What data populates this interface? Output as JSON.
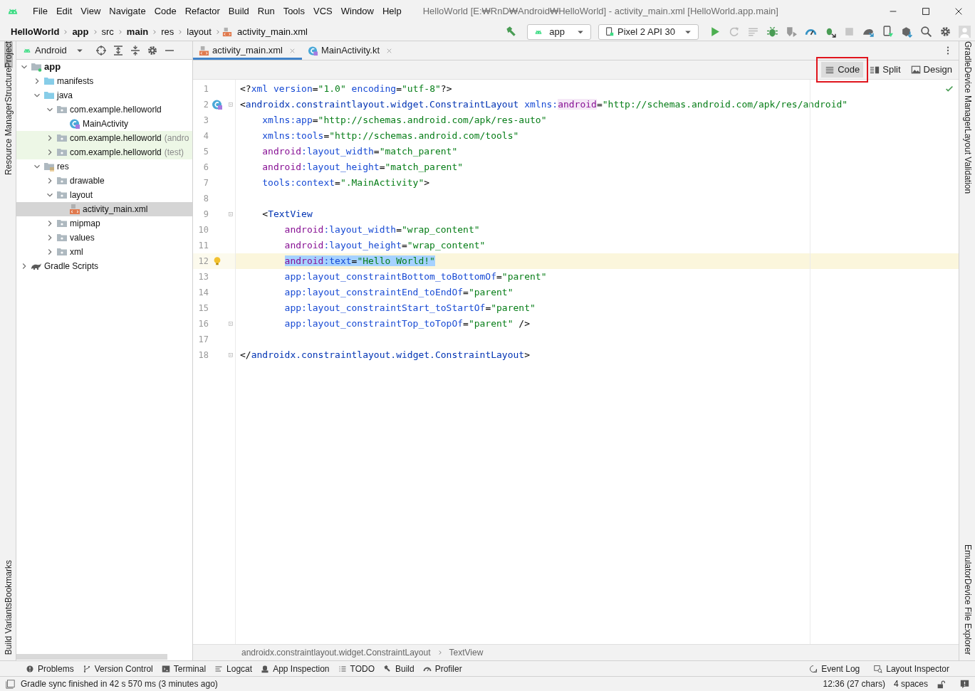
{
  "window": {
    "title": "HelloWorld [E:₩RnD₩Android₩HelloWorld] - activity_main.xml [HelloWorld.app.main]"
  },
  "menu": [
    "File",
    "Edit",
    "View",
    "Navigate",
    "Code",
    "Refactor",
    "Build",
    "Run",
    "Tools",
    "VCS",
    "Window",
    "Help"
  ],
  "nav_bar": {
    "breadcrumbs": [
      {
        "label": "HelloWorld",
        "bold": true,
        "kind": "text"
      },
      {
        "label": "app",
        "bold": true,
        "kind": "text"
      },
      {
        "label": "src",
        "bold": false,
        "kind": "text"
      },
      {
        "label": "main",
        "bold": true,
        "kind": "text"
      },
      {
        "label": "res",
        "bold": false,
        "kind": "text"
      },
      {
        "label": "layout",
        "bold": false,
        "kind": "text"
      },
      {
        "label": "activity_main.xml",
        "bold": false,
        "kind": "xml"
      }
    ]
  },
  "toolbar": {
    "run_config": "app",
    "device": "Pixel 2 API 30"
  },
  "stripes": {
    "left_top": [
      {
        "label": "Project",
        "selected": true
      },
      {
        "label": "Structure",
        "selected": false
      },
      {
        "label": "Resource Manager",
        "selected": false
      }
    ],
    "left_bottom": [
      {
        "label": "Bookmarks",
        "selected": false
      },
      {
        "label": "Build Variants",
        "selected": false
      }
    ],
    "right_top": [
      {
        "label": "Gradle",
        "selected": false
      },
      {
        "label": "Device Manager",
        "selected": false
      },
      {
        "label": "Layout Validation",
        "selected": false
      }
    ],
    "right_bottom": [
      {
        "label": "Emulator",
        "selected": false
      },
      {
        "label": "Device File Explorer",
        "selected": false
      }
    ]
  },
  "project_panel": {
    "view": "Android",
    "tree": [
      {
        "label": "app",
        "kind": "module",
        "expanded": true,
        "selected": false,
        "test_scope": false,
        "children": [
          {
            "label": "manifests",
            "kind": "folder",
            "expanded": false,
            "selected": false,
            "test_scope": false
          },
          {
            "label": "java",
            "kind": "folder",
            "expanded": true,
            "selected": false,
            "test_scope": false,
            "children": [
              {
                "label": "com.example.helloworld",
                "kind": "package",
                "expanded": true,
                "selected": false,
                "test_scope": false,
                "children": [
                  {
                    "label": "MainActivity",
                    "kind": "class",
                    "selected": false,
                    "test_scope": false
                  }
                ]
              },
              {
                "label": "com.example.helloworld",
                "suffix": "(andro",
                "kind": "package",
                "expanded": false,
                "selected": false,
                "test_scope": true
              },
              {
                "label": "com.example.helloworld",
                "suffix": "(test)",
                "kind": "package",
                "expanded": false,
                "selected": false,
                "test_scope": true
              }
            ]
          },
          {
            "label": "res",
            "kind": "resfolder",
            "expanded": true,
            "selected": false,
            "test_scope": false,
            "children": [
              {
                "label": "drawable",
                "kind": "package",
                "expanded": false,
                "selected": false,
                "test_scope": false
              },
              {
                "label": "layout",
                "kind": "package",
                "expanded": true,
                "selected": false,
                "test_scope": false,
                "children": [
                  {
                    "label": "activity_main.xml",
                    "kind": "xml",
                    "selected": true,
                    "test_scope": false
                  }
                ]
              },
              {
                "label": "mipmap",
                "kind": "package",
                "expanded": false,
                "selected": false,
                "test_scope": false
              },
              {
                "label": "values",
                "kind": "package",
                "expanded": false,
                "selected": false,
                "test_scope": false
              },
              {
                "label": "xml",
                "kind": "package",
                "expanded": false,
                "selected": false,
                "test_scope": false
              }
            ]
          }
        ]
      },
      {
        "label": "Gradle Scripts",
        "kind": "gradle",
        "expanded": false,
        "selected": false,
        "test_scope": false
      }
    ]
  },
  "editor": {
    "tabs": [
      {
        "label": "activity_main.xml",
        "kind": "xml",
        "selected": true
      },
      {
        "label": "MainActivity.kt",
        "kind": "class",
        "selected": false
      }
    ],
    "view_modes": [
      {
        "label": "Code",
        "kind": "code",
        "selected": true,
        "outlined": true
      },
      {
        "label": "Split",
        "kind": "split",
        "selected": false,
        "outlined": false
      },
      {
        "label": "Design",
        "kind": "design",
        "selected": false,
        "outlined": false
      }
    ],
    "lines": [
      {
        "number": "1",
        "kind": "plain",
        "indented": false,
        "nested": false,
        "current": false,
        "fold": false,
        "tokens": [
          {
            "kind": "punct",
            "text": "<?"
          },
          {
            "kind": "attr",
            "text": "xml"
          },
          {
            "kind": "attr",
            "text": " version"
          },
          {
            "kind": "punct",
            "text": "="
          },
          {
            "kind": "value",
            "text": "\"1.0\""
          },
          {
            "kind": "attr",
            "text": " encoding"
          },
          {
            "kind": "punct",
            "text": "="
          },
          {
            "kind": "value",
            "text": "\"utf-8\""
          },
          {
            "kind": "punct",
            "text": "?>"
          }
        ]
      },
      {
        "number": "2",
        "kind": "class_marker",
        "indented": false,
        "nested": false,
        "current": false,
        "fold": true,
        "tokens": [
          {
            "kind": "punct",
            "text": "<"
          },
          {
            "kind": "tag",
            "text": "androidx.constraintlayout.widget.ConstraintLayout"
          },
          {
            "kind": "attr",
            "text": " xmlns:"
          },
          {
            "kind": "nsdecl",
            "text": "android"
          },
          {
            "kind": "punct",
            "text": "="
          },
          {
            "kind": "value",
            "text": "\"http://schemas.android.com/apk/res/android\""
          }
        ]
      },
      {
        "number": "3",
        "kind": "plain",
        "indented": true,
        "nested": false,
        "current": false,
        "fold": false,
        "tokens": [
          {
            "kind": "attr",
            "text": "xmlns:app"
          },
          {
            "kind": "punct",
            "text": "="
          },
          {
            "kind": "value",
            "text": "\"http://schemas.android.com/apk/res-auto\""
          }
        ]
      },
      {
        "number": "4",
        "kind": "plain",
        "indented": true,
        "nested": false,
        "current": false,
        "fold": false,
        "tokens": [
          {
            "kind": "attr",
            "text": "xmlns:tools"
          },
          {
            "kind": "punct",
            "text": "="
          },
          {
            "kind": "value",
            "text": "\"http://schemas.android.com/tools\""
          }
        ]
      },
      {
        "number": "5",
        "kind": "plain",
        "indented": true,
        "nested": false,
        "current": false,
        "fold": false,
        "tokens": [
          {
            "kind": "ns",
            "text": "android"
          },
          {
            "kind": "attr",
            "text": ":layout_width"
          },
          {
            "kind": "punct",
            "text": "="
          },
          {
            "kind": "value",
            "text": "\"match_parent\""
          }
        ]
      },
      {
        "number": "6",
        "kind": "plain",
        "indented": true,
        "nested": false,
        "current": false,
        "fold": false,
        "tokens": [
          {
            "kind": "ns",
            "text": "android"
          },
          {
            "kind": "attr",
            "text": ":layout_height"
          },
          {
            "kind": "punct",
            "text": "="
          },
          {
            "kind": "value",
            "text": "\"match_parent\""
          }
        ]
      },
      {
        "number": "7",
        "kind": "plain",
        "indented": true,
        "nested": false,
        "current": false,
        "fold": false,
        "tokens": [
          {
            "kind": "attr",
            "text": "tools:context"
          },
          {
            "kind": "punct",
            "text": "="
          },
          {
            "kind": "value",
            "text": "\".MainActivity\""
          },
          {
            "kind": "punct",
            "text": ">"
          }
        ]
      },
      {
        "number": "8",
        "kind": "plain",
        "current": false,
        "fold": false
      },
      {
        "number": "9",
        "kind": "plain",
        "indented": true,
        "nested": false,
        "current": false,
        "fold": true,
        "tokens": [
          {
            "kind": "punct",
            "text": "<"
          },
          {
            "kind": "tag",
            "text": "TextView"
          }
        ]
      },
      {
        "number": "10",
        "kind": "plain",
        "indented": true,
        "nested": true,
        "current": false,
        "fold": false,
        "tokens": [
          {
            "kind": "ns",
            "text": "android"
          },
          {
            "kind": "attr",
            "text": ":layout_width"
          },
          {
            "kind": "punct",
            "text": "="
          },
          {
            "kind": "value",
            "text": "\"wrap_content\""
          }
        ]
      },
      {
        "number": "11",
        "kind": "plain",
        "indented": true,
        "nested": true,
        "current": false,
        "fold": false,
        "tokens": [
          {
            "kind": "ns",
            "text": "android"
          },
          {
            "kind": "attr",
            "text": ":layout_height"
          },
          {
            "kind": "punct",
            "text": "="
          },
          {
            "kind": "value",
            "text": "\"wrap_content\""
          }
        ]
      },
      {
        "number": "12",
        "kind": "bulb_marker",
        "indented": true,
        "nested": true,
        "current": true,
        "fold": false,
        "tokens": [
          {
            "kind": "ns",
            "text": "android",
            "selected": true
          },
          {
            "kind": "attr",
            "text": ":text",
            "selected": true
          },
          {
            "kind": "punct",
            "text": "=",
            "selected": true
          },
          {
            "kind": "value",
            "text": "\"Hello World!\"",
            "selected": true
          }
        ]
      },
      {
        "number": "13",
        "kind": "plain",
        "indented": true,
        "nested": true,
        "current": false,
        "fold": false,
        "tokens": [
          {
            "kind": "attr",
            "text": "app:layout_constraintBottom_toBottomOf"
          },
          {
            "kind": "punct",
            "text": "="
          },
          {
            "kind": "value",
            "text": "\"parent\""
          }
        ]
      },
      {
        "number": "14",
        "kind": "plain",
        "indented": true,
        "nested": true,
        "current": false,
        "fold": false,
        "tokens": [
          {
            "kind": "attr",
            "text": "app:layout_constraintEnd_toEndOf"
          },
          {
            "kind": "punct",
            "text": "="
          },
          {
            "kind": "value",
            "text": "\"parent\""
          }
        ]
      },
      {
        "number": "15",
        "kind": "plain",
        "indented": true,
        "nested": true,
        "current": false,
        "fold": false,
        "tokens": [
          {
            "kind": "attr",
            "text": "app:layout_constraintStart_toStartOf"
          },
          {
            "kind": "punct",
            "text": "="
          },
          {
            "kind": "value",
            "text": "\"parent\""
          }
        ]
      },
      {
        "number": "16",
        "kind": "plain",
        "indented": true,
        "nested": true,
        "current": false,
        "fold": true,
        "tokens": [
          {
            "kind": "attr",
            "text": "app:layout_constraintTop_toTopOf"
          },
          {
            "kind": "punct",
            "text": "="
          },
          {
            "kind": "value",
            "text": "\"parent\""
          },
          {
            "kind": "punct",
            "text": " />"
          }
        ]
      },
      {
        "number": "17",
        "kind": "plain",
        "current": false,
        "fold": false
      },
      {
        "number": "18",
        "kind": "plain",
        "indented": false,
        "nested": false,
        "current": false,
        "fold": true,
        "tokens": [
          {
            "kind": "punct",
            "text": "</"
          },
          {
            "kind": "tag",
            "text": "androidx.constraintlayout.widget.ConstraintLayout"
          },
          {
            "kind": "punct",
            "text": ">"
          }
        ]
      }
    ],
    "breadcrumbs": [
      "androidx.constraintlayout.widget.ConstraintLayout",
      "TextView"
    ]
  },
  "bottom_tools": {
    "left": [
      {
        "label": "Problems",
        "kind": "problems"
      },
      {
        "label": "Version Control",
        "kind": "vcs"
      },
      {
        "label": "Terminal",
        "kind": "terminal"
      },
      {
        "label": "Logcat",
        "kind": "logcat"
      },
      {
        "label": "App Inspection",
        "kind": "inspection"
      },
      {
        "label": "TODO",
        "kind": "todo"
      },
      {
        "label": "Build",
        "kind": "build"
      },
      {
        "label": "Profiler",
        "kind": "profiler"
      }
    ],
    "right": [
      {
        "label": "Event Log",
        "kind": "eventlog"
      },
      {
        "label": "Layout Inspector",
        "kind": "inspector"
      }
    ]
  },
  "status_bar": {
    "message": "Gradle sync finished in 42 s 570 ms (3 minutes ago)",
    "position": "12:36 (27 chars)",
    "indent": "4 spaces"
  }
}
